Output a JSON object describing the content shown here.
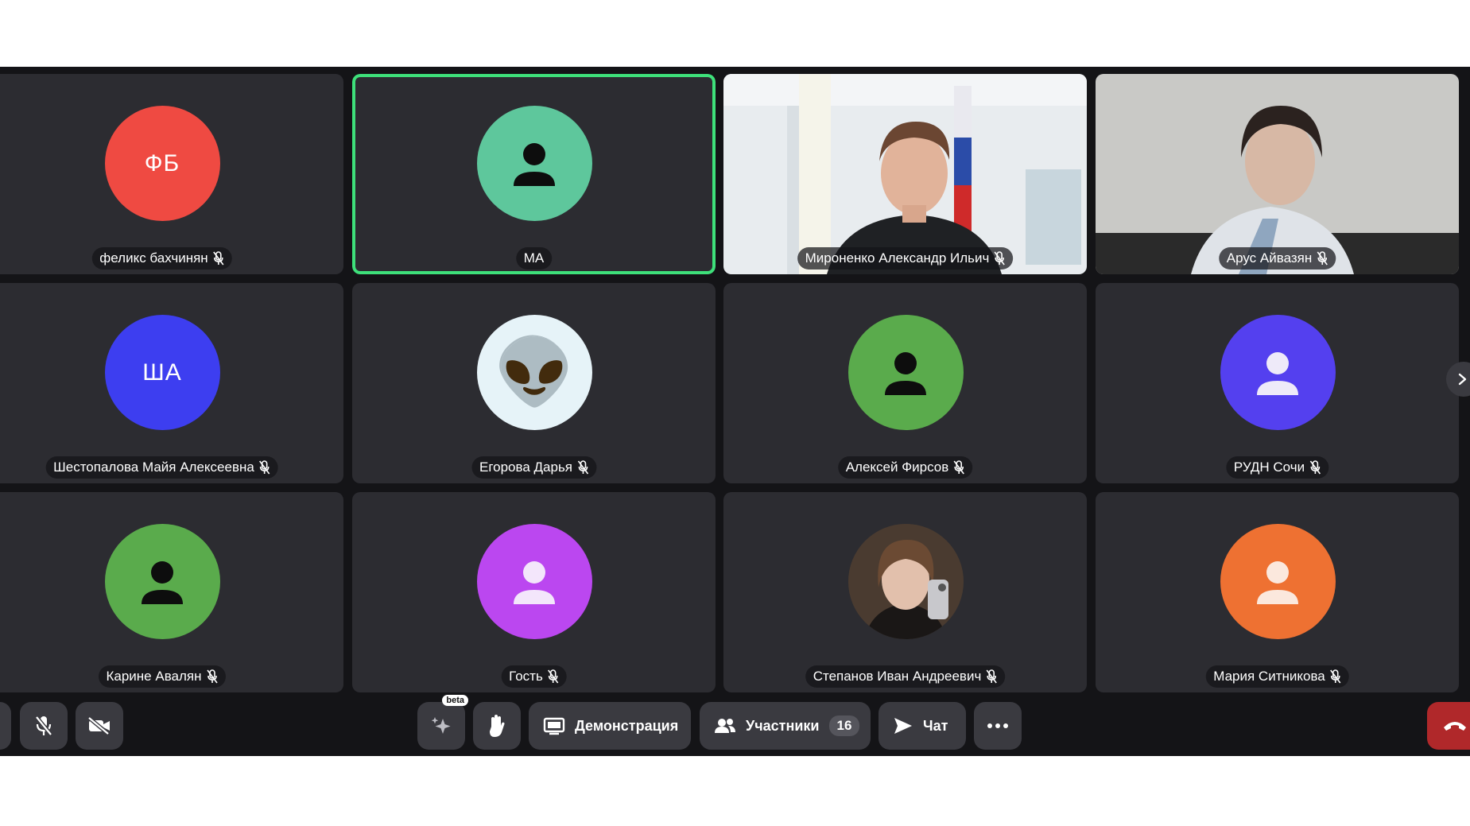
{
  "participants": [
    {
      "name": "феликс бахчинян",
      "initials": "ФБ",
      "avatar_color": "#ef4a42",
      "muted": true
    },
    {
      "name": "МА",
      "initials": "",
      "avatar_color": "#5ec79c",
      "muted": false,
      "active_speaker": true
    },
    {
      "name": "Мироненко Александр Ильич",
      "muted": true,
      "video": true
    },
    {
      "name": "Арус Айвазян",
      "muted": true,
      "video": true
    },
    {
      "name": "Шестопалова Майя Алексеевна",
      "initials": "ША",
      "avatar_color": "#3d3ef0",
      "muted": true
    },
    {
      "name": "Егорова Дарья",
      "avatar_emoji": "👽",
      "avatar_color": "#e6f3f8",
      "muted": true
    },
    {
      "name": "Алексей Фирсов",
      "avatar_color": "#5aab4c",
      "muted": true
    },
    {
      "name": "РУДН Сочи",
      "avatar_color": "#5440ef",
      "muted": true
    },
    {
      "name": "Карине Авалян",
      "avatar_color": "#5aab4c",
      "muted": true
    },
    {
      "name": "Гость",
      "avatar_color": "#bb47f0",
      "muted": true
    },
    {
      "name": "Степанов Иван Андреевич",
      "muted": true,
      "photo_avatar": true
    },
    {
      "name": "Мария Ситникова",
      "avatar_color": "#ee7132",
      "muted": true
    }
  ],
  "toolbar": {
    "beta_label": "beta",
    "demo_label": "Демонстрация",
    "participants_label": "Участники",
    "participants_count": "16",
    "chat_label": "Чат"
  },
  "colors": {
    "active_border": "#3ee07a",
    "tile_bg": "#2c2c31",
    "stage_bg": "#141417",
    "hangup": "#b0282a"
  }
}
